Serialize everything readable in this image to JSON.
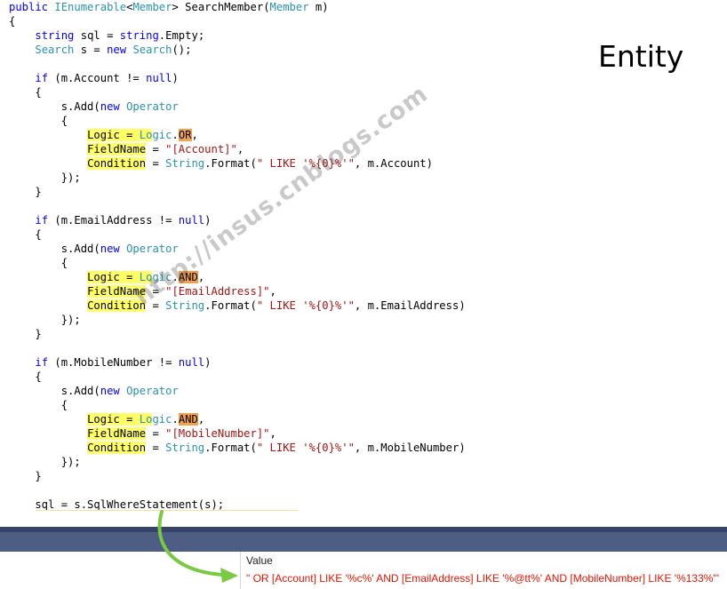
{
  "editor": {
    "lines": [
      [
        {
          "t": "public",
          "c": "kw"
        },
        {
          "t": " ",
          "c": "plain"
        },
        {
          "t": "IEnumerable",
          "c": "type"
        },
        {
          "t": "<",
          "c": "plain"
        },
        {
          "t": "Member",
          "c": "type"
        },
        {
          "t": "> SearchMember(",
          "c": "plain"
        },
        {
          "t": "Member",
          "c": "type"
        },
        {
          "t": " m)",
          "c": "plain"
        }
      ],
      [
        {
          "t": "{",
          "c": "plain"
        }
      ],
      [
        {
          "t": "    ",
          "c": "plain"
        },
        {
          "t": "string",
          "c": "kw"
        },
        {
          "t": " sql = ",
          "c": "plain"
        },
        {
          "t": "string",
          "c": "kw"
        },
        {
          "t": ".Empty;",
          "c": "plain"
        }
      ],
      [
        {
          "t": "    ",
          "c": "plain"
        },
        {
          "t": "Search",
          "c": "type"
        },
        {
          "t": " s = ",
          "c": "plain"
        },
        {
          "t": "new",
          "c": "kw"
        },
        {
          "t": " ",
          "c": "plain"
        },
        {
          "t": "Search",
          "c": "type"
        },
        {
          "t": "();",
          "c": "plain"
        }
      ],
      [],
      [
        {
          "t": "    ",
          "c": "plain"
        },
        {
          "t": "if",
          "c": "kw"
        },
        {
          "t": " (m.Account != ",
          "c": "plain"
        },
        {
          "t": "null",
          "c": "kw"
        },
        {
          "t": ")",
          "c": "plain"
        }
      ],
      [
        {
          "t": "    {",
          "c": "plain"
        }
      ],
      [
        {
          "t": "        s.Add(",
          "c": "plain"
        },
        {
          "t": "new",
          "c": "kw"
        },
        {
          "t": " ",
          "c": "plain"
        },
        {
          "t": "Operator",
          "c": "type"
        }
      ],
      [
        {
          "t": "        {",
          "c": "plain"
        }
      ],
      [
        {
          "t": "            ",
          "c": "plain"
        },
        {
          "t": "Logic",
          "c": "plain",
          "h": "yellow"
        },
        {
          "t": " = ",
          "c": "plain",
          "h": "yellow"
        },
        {
          "t": "Lo",
          "c": "type",
          "h": "yellow"
        },
        {
          "t": "gic",
          "c": "type"
        },
        {
          "t": ".",
          "c": "plain"
        },
        {
          "t": "OR",
          "c": "plain",
          "h": "orange"
        },
        {
          "t": ",",
          "c": "plain"
        }
      ],
      [
        {
          "t": "            ",
          "c": "plain"
        },
        {
          "t": "FieldName",
          "c": "plain",
          "h": "yellow"
        },
        {
          "t": " = ",
          "c": "plain"
        },
        {
          "t": "\"[Account]\"",
          "c": "str"
        },
        {
          "t": ",",
          "c": "plain"
        }
      ],
      [
        {
          "t": "            ",
          "c": "plain"
        },
        {
          "t": "Condition",
          "c": "plain",
          "h": "yellow"
        },
        {
          "t": " = ",
          "c": "plain"
        },
        {
          "t": "String",
          "c": "type"
        },
        {
          "t": ".Format(",
          "c": "plain"
        },
        {
          "t": "\" LIKE '%{0}%'\"",
          "c": "str"
        },
        {
          "t": ", m.Account)",
          "c": "plain"
        }
      ],
      [
        {
          "t": "        });",
          "c": "plain"
        }
      ],
      [
        {
          "t": "    }",
          "c": "plain"
        }
      ],
      [],
      [
        {
          "t": "    ",
          "c": "plain"
        },
        {
          "t": "if",
          "c": "kw"
        },
        {
          "t": " (m.EmailAddress != ",
          "c": "plain"
        },
        {
          "t": "null",
          "c": "kw"
        },
        {
          "t": ")",
          "c": "plain"
        }
      ],
      [
        {
          "t": "    {",
          "c": "plain"
        }
      ],
      [
        {
          "t": "        s.Add(",
          "c": "plain"
        },
        {
          "t": "new",
          "c": "kw"
        },
        {
          "t": " ",
          "c": "plain"
        },
        {
          "t": "Operator",
          "c": "type"
        }
      ],
      [
        {
          "t": "        {",
          "c": "plain"
        }
      ],
      [
        {
          "t": "            ",
          "c": "plain"
        },
        {
          "t": "Logic",
          "c": "plain",
          "h": "yellow"
        },
        {
          "t": " = ",
          "c": "plain",
          "h": "yellow"
        },
        {
          "t": "Lo",
          "c": "type",
          "h": "yellow"
        },
        {
          "t": "gic",
          "c": "type"
        },
        {
          "t": ".",
          "c": "plain"
        },
        {
          "t": "AND",
          "c": "plain",
          "h": "orange"
        },
        {
          "t": ",",
          "c": "plain"
        }
      ],
      [
        {
          "t": "            ",
          "c": "plain"
        },
        {
          "t": "FieldName",
          "c": "plain",
          "h": "yellow"
        },
        {
          "t": " = ",
          "c": "plain"
        },
        {
          "t": "\"[EmailAddress]\"",
          "c": "str"
        },
        {
          "t": ",",
          "c": "plain"
        }
      ],
      [
        {
          "t": "            ",
          "c": "plain"
        },
        {
          "t": "Condition",
          "c": "plain",
          "h": "yellow"
        },
        {
          "t": " = ",
          "c": "plain"
        },
        {
          "t": "String",
          "c": "type"
        },
        {
          "t": ".Format(",
          "c": "plain"
        },
        {
          "t": "\" LIKE '%{0}%'\"",
          "c": "str"
        },
        {
          "t": ", m.EmailAddress)",
          "c": "plain"
        }
      ],
      [
        {
          "t": "        });",
          "c": "plain"
        }
      ],
      [
        {
          "t": "    }",
          "c": "plain"
        }
      ],
      [],
      [
        {
          "t": "    ",
          "c": "plain"
        },
        {
          "t": "if",
          "c": "kw"
        },
        {
          "t": " (m.MobileNumber != ",
          "c": "plain"
        },
        {
          "t": "null",
          "c": "kw"
        },
        {
          "t": ")",
          "c": "plain"
        }
      ],
      [
        {
          "t": "    {",
          "c": "plain"
        }
      ],
      [
        {
          "t": "        s.Add(",
          "c": "plain"
        },
        {
          "t": "new",
          "c": "kw"
        },
        {
          "t": " ",
          "c": "plain"
        },
        {
          "t": "Operator",
          "c": "type"
        }
      ],
      [
        {
          "t": "        {",
          "c": "plain"
        }
      ],
      [
        {
          "t": "            ",
          "c": "plain"
        },
        {
          "t": "Logic",
          "c": "plain",
          "h": "yellow"
        },
        {
          "t": " = ",
          "c": "plain",
          "h": "yellow"
        },
        {
          "t": "Lo",
          "c": "type",
          "h": "yellow"
        },
        {
          "t": "gic",
          "c": "type"
        },
        {
          "t": ".",
          "c": "plain"
        },
        {
          "t": "AND",
          "c": "plain",
          "h": "orange"
        },
        {
          "t": ",",
          "c": "plain"
        }
      ],
      [
        {
          "t": "            ",
          "c": "plain"
        },
        {
          "t": "FieldName",
          "c": "plain",
          "h": "yellow"
        },
        {
          "t": " = ",
          "c": "plain"
        },
        {
          "t": "\"[MobileNumber]\"",
          "c": "str"
        },
        {
          "t": ",",
          "c": "plain"
        }
      ],
      [
        {
          "t": "            ",
          "c": "plain"
        },
        {
          "t": "Condition",
          "c": "plain",
          "h": "yellow"
        },
        {
          "t": " = ",
          "c": "plain"
        },
        {
          "t": "String",
          "c": "type"
        },
        {
          "t": ".Format(",
          "c": "plain"
        },
        {
          "t": "\" LIKE '%{0}%'\"",
          "c": "str"
        },
        {
          "t": ", m.MobileNumber)",
          "c": "plain"
        }
      ],
      [
        {
          "t": "        });",
          "c": "plain"
        }
      ],
      [
        {
          "t": "    }",
          "c": "plain"
        }
      ],
      [],
      [
        {
          "t": "    sql = s.SqlWhereStatement(s);",
          "c": "plain"
        }
      ]
    ]
  },
  "annotation": {
    "label": "Entity"
  },
  "watermark": {
    "text": "http://insus.cnblogs.com"
  },
  "watch": {
    "column_header": "Value",
    "value": "\" OR [Account] LIKE '%c%' AND [EmailAddress] LIKE '%@tt%' AND [MobileNumber] LIKE '%133%'\""
  },
  "colors": {
    "keyword": "#0000ff",
    "type": "#2b91af",
    "string": "#a31515",
    "highlight_yellow": "#ffff66",
    "highlight_orange": "#f5a04a",
    "watch_value": "#e51400",
    "panel": "#4e5d84",
    "arrow": "#7ac943"
  },
  "icons": {
    "arrow": "curved-arrow-icon"
  }
}
